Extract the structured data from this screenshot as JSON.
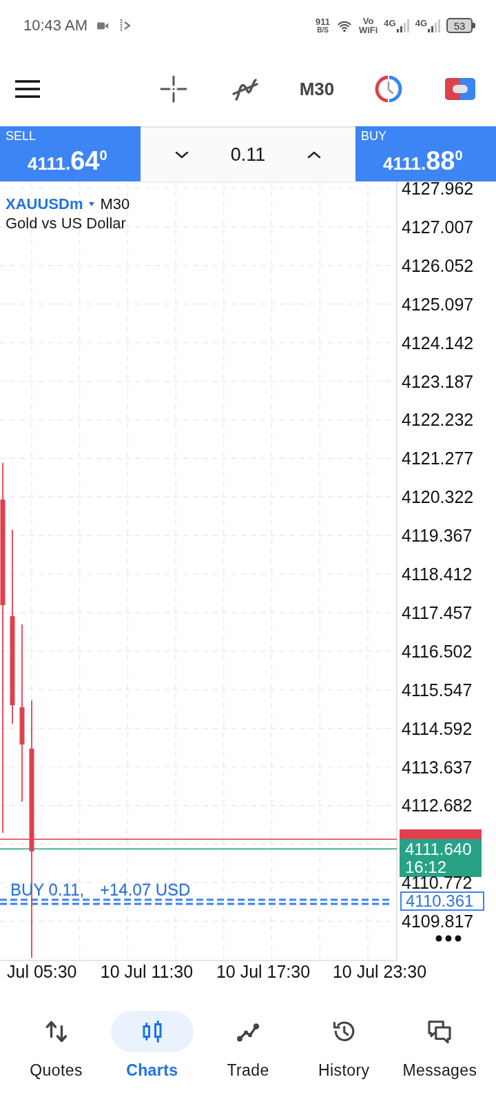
{
  "status_bar": {
    "time": "10:43 AM",
    "net_speed": "911",
    "net_speed_unit": "B/S",
    "calling_label": [
      "Vo",
      "WiFi"
    ],
    "networks": [
      "4G",
      "4G"
    ],
    "battery": "53"
  },
  "toolbar": {
    "timeframe": "M30"
  },
  "trade_panel": {
    "sell": {
      "label": "SELL",
      "price_prefix": "4111.",
      "price_main": "64",
      "price_sup": "0"
    },
    "volume": "0.11",
    "buy": {
      "label": "BUY",
      "price_prefix": "4111.",
      "price_main": "88",
      "price_sup": "0"
    }
  },
  "chart": {
    "symbol": "XAUUSDm",
    "timeframe": "M30",
    "description": "Gold vs US Dollar",
    "price_axis": [
      "4127.962",
      "4127.007",
      "4126.052",
      "4125.097",
      "4124.142",
      "4123.187",
      "4122.232",
      "4121.277",
      "4120.322",
      "4119.367",
      "4118.412",
      "4117.457",
      "4116.502",
      "4115.547",
      "4114.592",
      "4113.637",
      "4112.682"
    ],
    "bid_tag": {
      "price": "4111.640",
      "countdown": "16:12"
    },
    "price_axis_lower": [
      "4110.772",
      "4109.817"
    ],
    "position_tag": "4110.361",
    "position": {
      "label": "BUY 0.11,",
      "profit": "+14.07 USD"
    },
    "time_axis": [
      "Jul 05:30",
      "10 Jul 11:30",
      "10 Jul 17:30",
      "10 Jul 23:30"
    ]
  },
  "nav": [
    {
      "label": "Quotes",
      "selected": false
    },
    {
      "label": "Charts",
      "selected": true
    },
    {
      "label": "Trade",
      "selected": false
    },
    {
      "label": "History",
      "selected": false
    },
    {
      "label": "Messages",
      "selected": false
    }
  ]
}
